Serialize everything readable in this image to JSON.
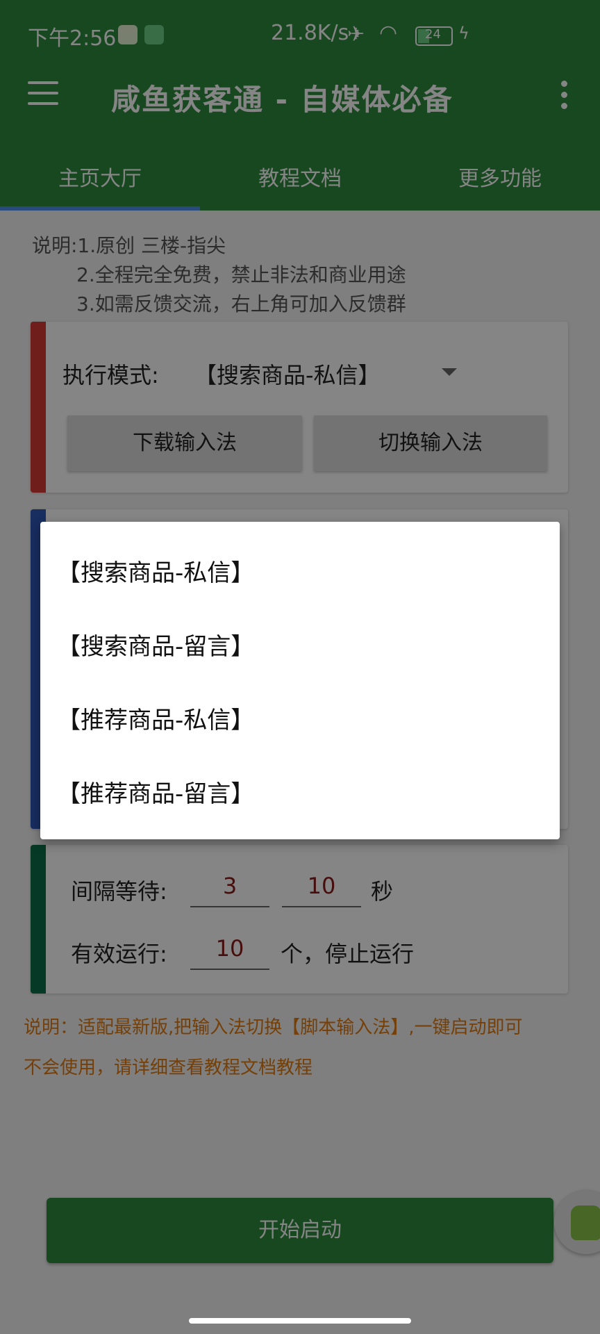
{
  "status_bar": {
    "time": "下午2:56",
    "speed": "21.8K/s",
    "battery": "24"
  },
  "app_bar": {
    "title": "咸鱼获客通 - 自媒体必备"
  },
  "tabs": [
    {
      "label": "主页大厅",
      "selected": true
    },
    {
      "label": "教程文档",
      "selected": false
    },
    {
      "label": "更多功能",
      "selected": false
    }
  ],
  "notes": {
    "line1": "说明:1.原创 三楼-指尖",
    "line2": "2.全程完全免费，禁止非法和商业用途",
    "line3": "3.如需反馈交流，右上角可加入反馈群"
  },
  "mode_card": {
    "label": "执行模式:",
    "value": "【搜索商品-私信】",
    "download_ime": "下载输入法",
    "switch_ime": "切换输入法"
  },
  "settings_card": {
    "interval_label": "间隔等待:",
    "interval_min": "3",
    "interval_max": "10",
    "interval_unit": "秒",
    "run_label": "有效运行:",
    "run_count": "10",
    "run_suffix": "个，停止运行"
  },
  "footer_notes": {
    "line1": "说明：适配最新版,把输入法切换【脚本输入法】,一键启动即可",
    "line2": "不会使用，请详细查看教程文档教程"
  },
  "start_button": "开始启动",
  "dialog_options": [
    "【搜索商品-私信】",
    "【搜索商品-留言】",
    "【推荐商品-私信】",
    "【推荐商品-留言】"
  ],
  "colors": {
    "primary": "#2e8a3e",
    "tab_indicator": "#4d8ef0",
    "card_red": "#d53a35",
    "card_blue": "#2f56b8",
    "card_green": "#0d6e4a",
    "note_orange": "#e07a10"
  }
}
